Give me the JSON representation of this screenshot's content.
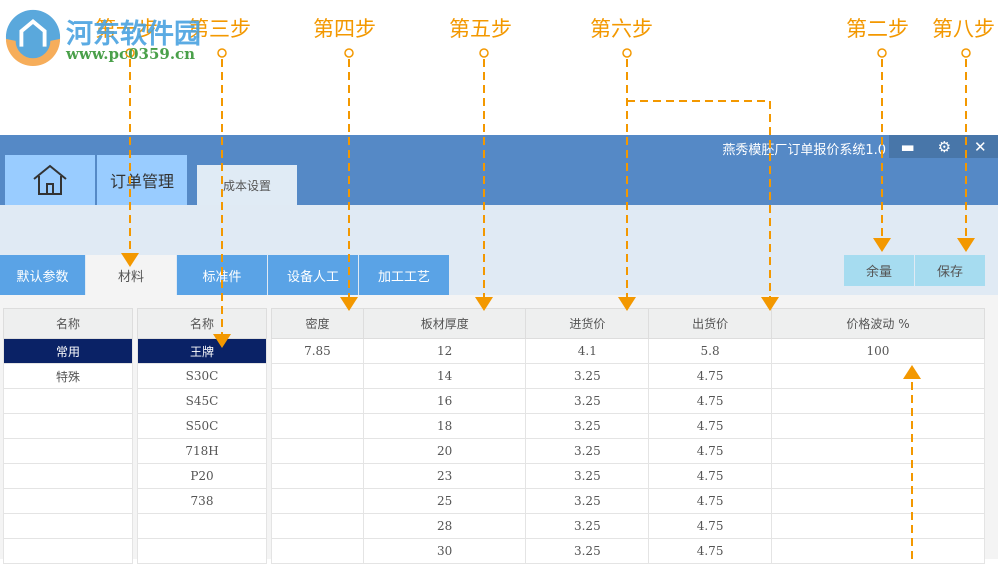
{
  "watermark": {
    "name": "河东软件园",
    "url": "www.pc0359.cn"
  },
  "annotations": {
    "step1": "第一步",
    "step2": "第二步",
    "step3": "第三步",
    "step4": "第四步",
    "step5": "第五步",
    "step6": "第六步",
    "step8": "第八步"
  },
  "window": {
    "title": "燕秀模胚厂订单报价系统1.0",
    "minimize": "minimize-icon",
    "settings": "gear-icon",
    "close": "close-icon"
  },
  "main_tabs": [
    {
      "icon": "home-icon"
    },
    {
      "label": "订单管理"
    },
    {
      "label": "成本设置"
    }
  ],
  "sub_tabs": [
    "默认参数",
    "材料",
    "标准件",
    "设备人工",
    "加工工艺"
  ],
  "buttons": {
    "margin": "余量",
    "save": "保存"
  },
  "category_table": {
    "header": "名称",
    "rows": [
      "常用",
      "特殊",
      "",
      "",
      "",
      "",
      "",
      "",
      ""
    ],
    "selected": 0
  },
  "material_table": {
    "header": "名称",
    "rows": [
      "王牌",
      "S30C",
      "S45C",
      "S50C",
      "718H",
      "P20",
      "738",
      "",
      ""
    ],
    "selected": 0
  },
  "price_table": {
    "headers": [
      "密度",
      "板材厚度",
      "进货价",
      "出货价",
      "价格波动 %"
    ],
    "rows": [
      [
        "7.85",
        "12",
        "4.1",
        "5.8",
        "100"
      ],
      [
        "",
        "14",
        "3.25",
        "4.75",
        ""
      ],
      [
        "",
        "16",
        "3.25",
        "4.75",
        ""
      ],
      [
        "",
        "18",
        "3.25",
        "4.75",
        ""
      ],
      [
        "",
        "20",
        "3.25",
        "4.75",
        ""
      ],
      [
        "",
        "23",
        "3.25",
        "4.75",
        ""
      ],
      [
        "",
        "25",
        "3.25",
        "4.75",
        ""
      ],
      [
        "",
        "28",
        "3.25",
        "4.75",
        ""
      ],
      [
        "",
        "30",
        "3.25",
        "4.75",
        ""
      ]
    ]
  },
  "colors": {
    "accent": "#f39800",
    "titlebar": "#5589c6",
    "selected": "#0a2266"
  }
}
